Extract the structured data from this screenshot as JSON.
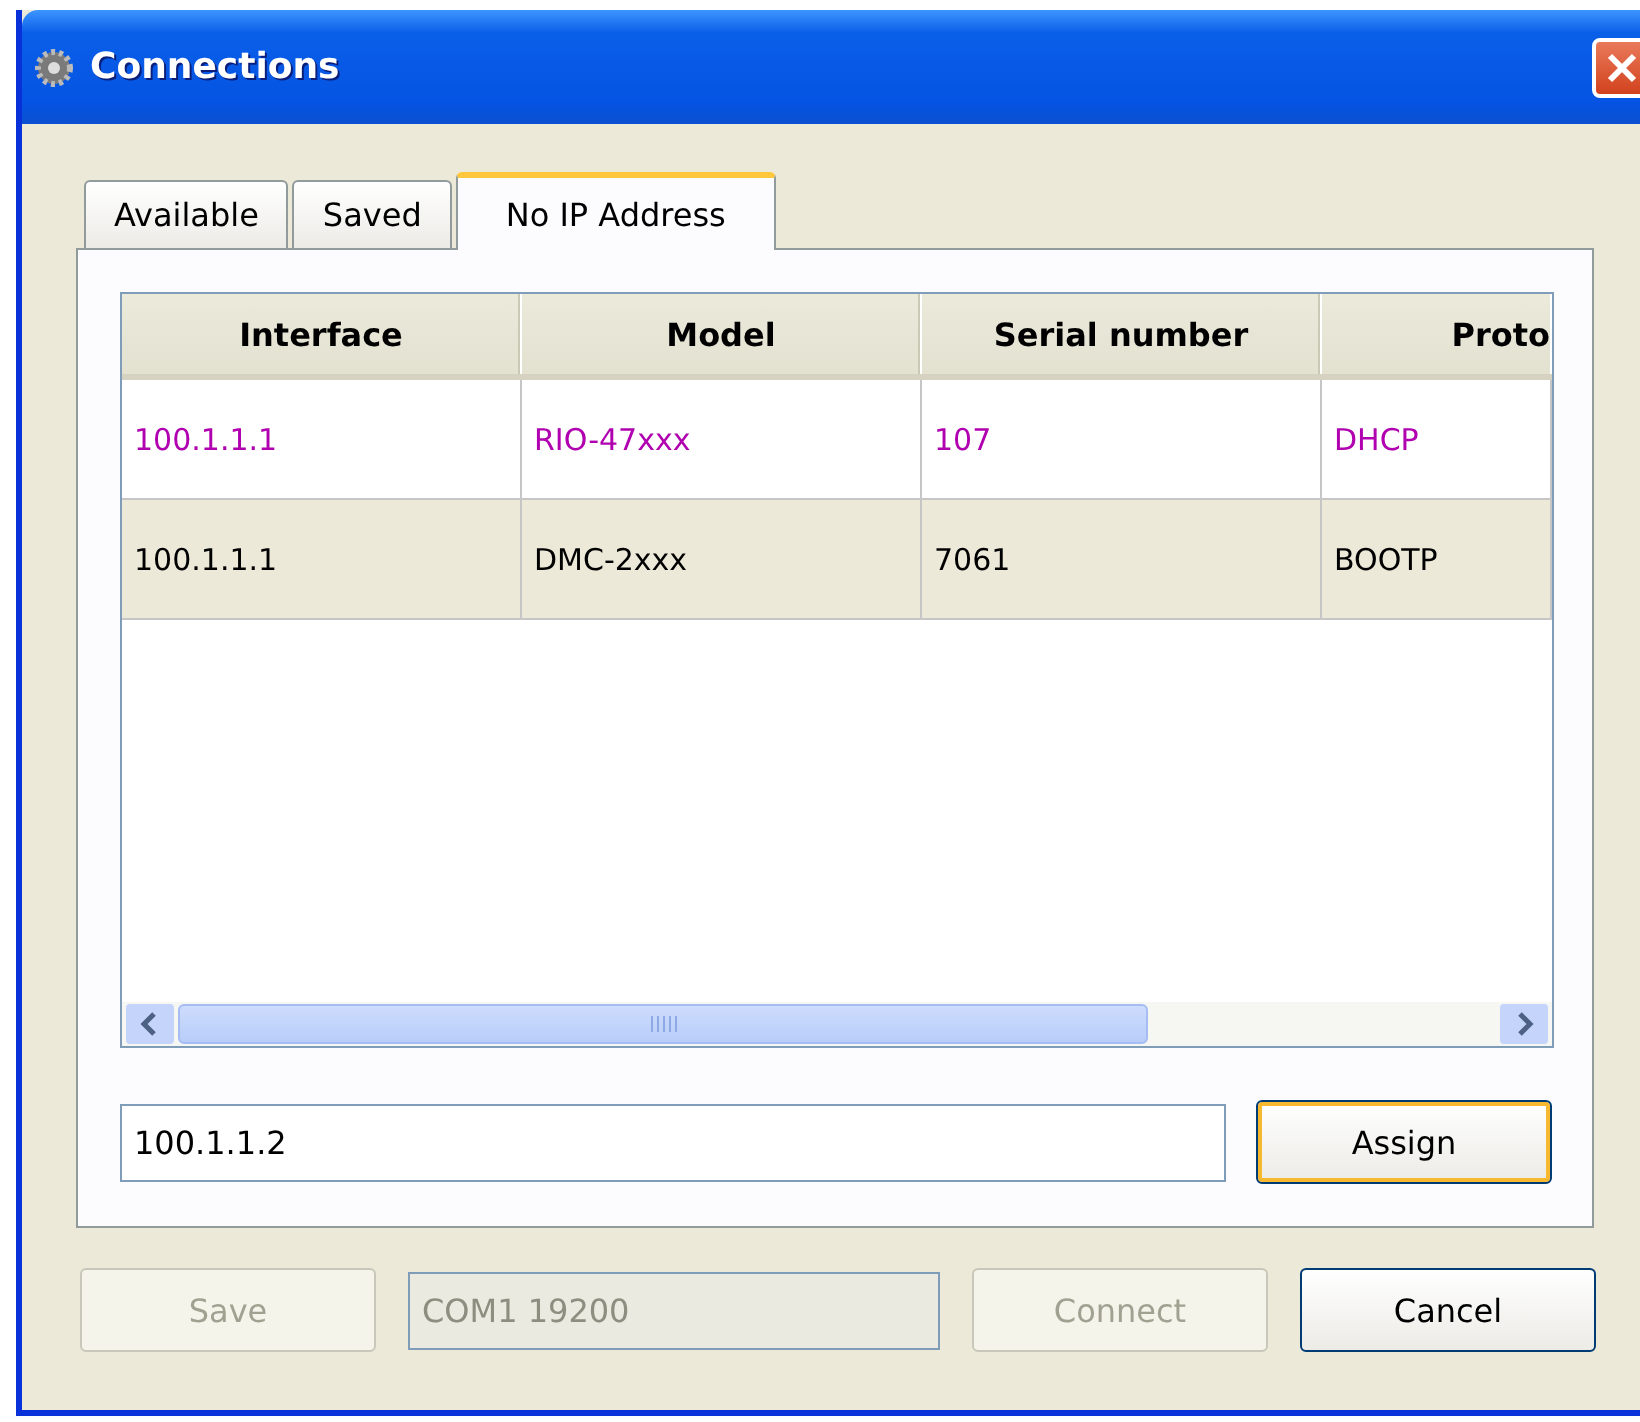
{
  "window": {
    "title": "Connections"
  },
  "tabs": [
    {
      "label": "Available",
      "selected": false
    },
    {
      "label": "Saved",
      "selected": false
    },
    {
      "label": "No IP Address",
      "selected": true
    }
  ],
  "table": {
    "columns": [
      "Interface",
      "Model",
      "Serial number",
      "Proto"
    ],
    "rows": [
      {
        "color": "#b000b0",
        "cells": [
          "100.1.1.1",
          "RIO-47xxx",
          "107",
          "DHCP"
        ]
      },
      {
        "color": "#000000",
        "cells": [
          "100.1.1.1",
          "DMC-2xxx",
          "7061",
          "BOOTP"
        ]
      }
    ]
  },
  "address_field": {
    "value": "100.1.1.2"
  },
  "assign_button": {
    "label": "Assign",
    "focused": true
  },
  "footer": [
    {
      "kind": "button",
      "label": "Save",
      "disabled": true
    },
    {
      "kind": "field",
      "value": "COM1 19200",
      "disabled": true
    },
    {
      "kind": "button",
      "label": "Connect",
      "disabled": true
    },
    {
      "kind": "button",
      "label": "Cancel",
      "disabled": false
    }
  ]
}
